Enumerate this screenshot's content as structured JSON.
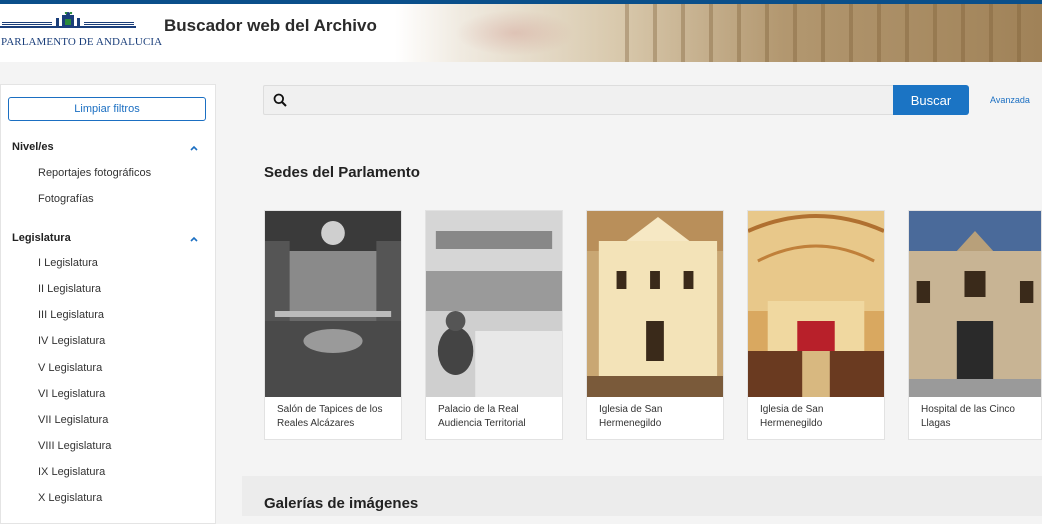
{
  "header": {
    "logo_text": "PARLAMENTO DE ANDALUCIA",
    "title": "Buscador web del Archivo"
  },
  "sidebar": {
    "clear_filters": "Limpiar filtros",
    "facets": [
      {
        "title": "Nivel/es",
        "items": [
          "Reportajes fotográficos",
          "Fotografías"
        ]
      },
      {
        "title": "Legislatura",
        "items": [
          "I Legislatura",
          "II Legislatura",
          "III Legislatura",
          "IV Legislatura",
          "V Legislatura",
          "VI Legislatura",
          "VII Legislatura",
          "VIII Legislatura",
          "IX Legislatura",
          "X Legislatura"
        ]
      }
    ]
  },
  "search": {
    "placeholder": "",
    "value": "",
    "button_label": "Buscar",
    "advanced_label": "Avanzada"
  },
  "sedes": {
    "title": "Sedes del Parlamento",
    "cards": [
      {
        "caption": "Salón de Tapices de los Reales Alcázares",
        "icon": "photo-bw-hall"
      },
      {
        "caption": "Palacio de la Real Audiencia Territorial",
        "icon": "photo-bw-chamber"
      },
      {
        "caption": "Iglesia de San Hermenegildo",
        "icon": "photo-church-facade"
      },
      {
        "caption": "Iglesia de San Hermenegildo",
        "icon": "photo-church-interior"
      },
      {
        "caption": "Hospital de las Cinco Llagas",
        "icon": "photo-hospital-facade"
      }
    ]
  },
  "galerias": {
    "title": "Galerías de imágenes"
  },
  "colors": {
    "accent": "#1b74c4",
    "topbar": "#0a4f8a"
  }
}
